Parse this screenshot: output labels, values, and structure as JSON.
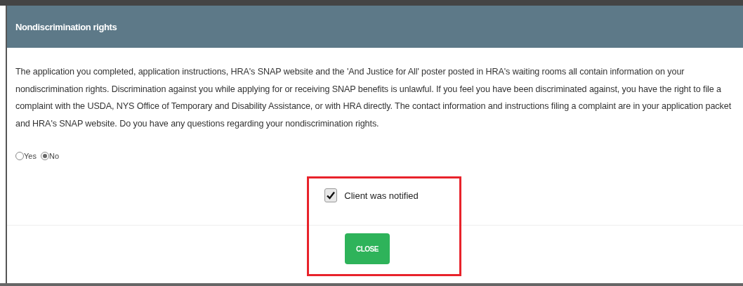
{
  "dialog": {
    "title": "Nondiscrimination rights",
    "body": "The application you completed, application instructions, HRA's SNAP website and the 'And Justice for All' poster posted in HRA's waiting rooms all contain information on your nondiscrimination rights. Discrimination against you while applying for or receiving SNAP benefits is unlawful. If you feel you have been discriminated against, you have the right to file a complaint with the USDA, NYS Office of Temporary and Disability Assistance, or with HRA directly. The contact information and instructions filing a complaint are in your application packet and HRA's SNAP website. Do you have any questions regarding your nondiscrimination rights.",
    "options": [
      {
        "label": "Yes",
        "selected": false
      },
      {
        "label": "No",
        "selected": true
      }
    ],
    "notified": {
      "label": "Client was notified",
      "checked": true
    },
    "close_button": "CLOSE"
  }
}
